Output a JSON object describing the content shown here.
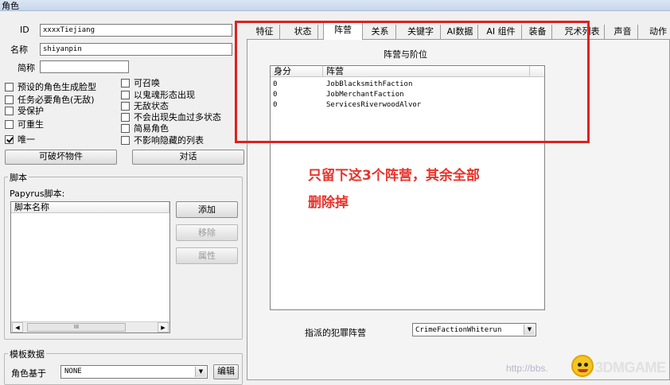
{
  "window": {
    "title": "角色"
  },
  "fields": {
    "id_label": "ID",
    "id_value": "xxxxTiejiang",
    "name_label": "名称",
    "name_value": "shiyanpin",
    "short_label": "简称",
    "short_value": ""
  },
  "checkboxes_left": [
    {
      "label": "预设的角色生成脸型",
      "checked": false
    },
    {
      "label": "任务必要角色(无敌)",
      "checked": false
    },
    {
      "label": "受保护",
      "checked": false
    },
    {
      "label": "可重生",
      "checked": false
    },
    {
      "label": "唯一",
      "checked": true
    }
  ],
  "checkboxes_right": [
    {
      "label": "可召唤",
      "checked": false
    },
    {
      "label": "以鬼魂形态出现",
      "checked": false
    },
    {
      "label": "无敌状态",
      "checked": false
    },
    {
      "label": "不会出现失血过多状态",
      "checked": false
    },
    {
      "label": "简易角色",
      "checked": false
    },
    {
      "label": "不影响隐藏的列表",
      "checked": false
    }
  ],
  "buttons": {
    "destructible": "可破坏物件",
    "dialogue": "对话"
  },
  "scripts": {
    "group_title": "脚本",
    "papyrus_label": "Papyrus脚本:",
    "column": "脚本名称",
    "add": "添加",
    "remove": "移除",
    "properties": "属性",
    "scroll_grip": "III"
  },
  "template": {
    "group_title": "模板数据",
    "based_on_label": "角色基于",
    "based_on_value": "NONE",
    "edit": "编辑"
  },
  "tabs": [
    "特征",
    "状态",
    "阵营",
    "关系",
    "关键字",
    "AI数据",
    "AI 组件",
    "装备",
    "咒术列表",
    "声音",
    "动作"
  ],
  "active_tab": "阵营",
  "factions": {
    "section_title": "阵营与阶位",
    "col_rank": "身分",
    "col_faction": "阵营",
    "rows": [
      {
        "rank": "0",
        "faction": "JobBlacksmithFaction"
      },
      {
        "rank": "0",
        "faction": "JobMerchantFaction"
      },
      {
        "rank": "0",
        "faction": "ServicesRiverwoodAlvor"
      }
    ]
  },
  "crime": {
    "label": "指派的犯罪阵营",
    "value": "CrimeFactionWhiterun"
  },
  "annotation": {
    "line1": "只留下这3个阵营，其余全部",
    "line2": "删除掉"
  },
  "watermark": {
    "url": "http://bbs.",
    "brand": "3DMGAME"
  },
  "colors": {
    "annotation": "#e8322a",
    "highlight_box": "#e02020"
  }
}
